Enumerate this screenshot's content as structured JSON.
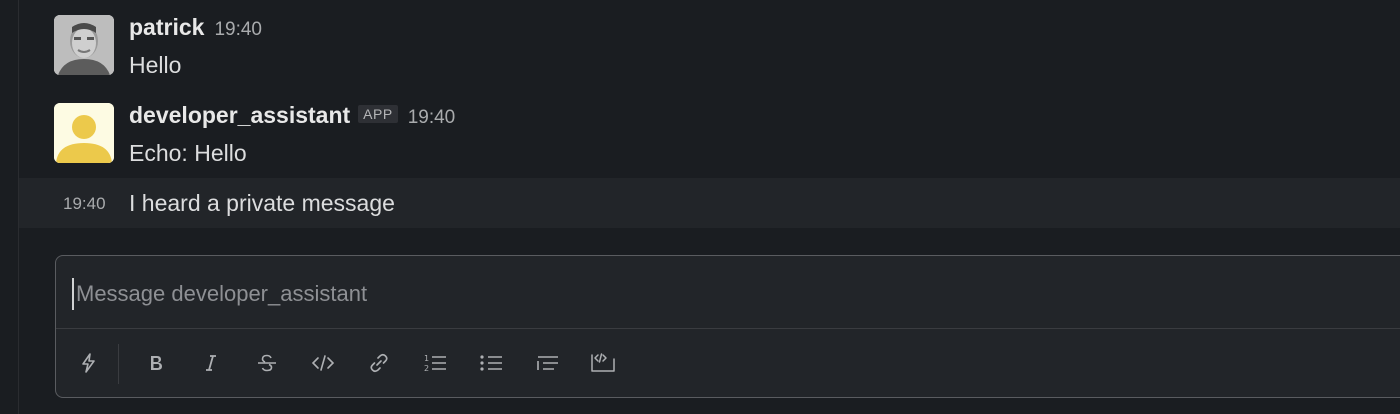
{
  "messages": [
    {
      "author": "patrick",
      "time": "19:40",
      "text": "Hello"
    },
    {
      "author": "developer_assistant",
      "badge": "APP",
      "time": "19:40",
      "text": "Echo: Hello"
    }
  ],
  "continuation": {
    "time": "19:40",
    "text": "I heard a private message"
  },
  "composer": {
    "placeholder": "Message developer_assistant",
    "value": ""
  },
  "toolbar_icons": [
    "lightning-icon",
    "bold-icon",
    "italic-icon",
    "strikethrough-icon",
    "code-icon",
    "link-icon",
    "numbered-list-icon",
    "bulleted-list-icon",
    "blockquote-icon",
    "code-block-icon"
  ],
  "colors": {
    "background": "#1a1d21",
    "hover_row": "#222529",
    "app_avatar_bg": "#fdfbe3",
    "app_avatar_fg": "#ecc94b"
  }
}
